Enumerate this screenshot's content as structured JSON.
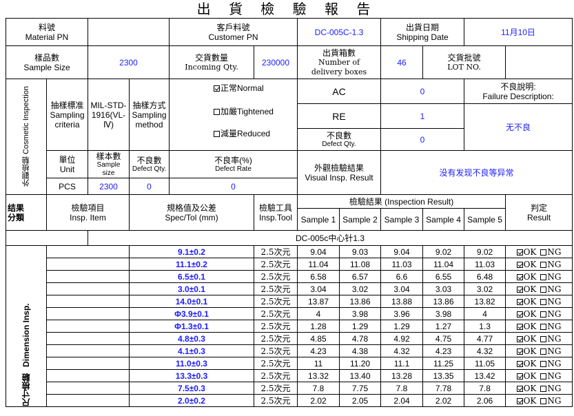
{
  "title": "出 貨 檢 驗 報 告",
  "header": {
    "material_pn_label_cn": "料號",
    "material_pn_label_en": "Material PN",
    "material_pn_value": "",
    "customer_pn_label_cn": "客戶料號",
    "customer_pn_label_en": "Customer PN",
    "customer_pn_value": "DC-005C-1.3",
    "shipping_date_label_cn": "出貨日期",
    "shipping_date_label_en": "Shipping Date",
    "shipping_date_value": "11月10日",
    "sample_size_label_cn": "樣品數",
    "sample_size_label_en": "Sample Size",
    "sample_size_value": "2300",
    "incoming_qty_label_cn": "交貨數量",
    "incoming_qty_label_en": "Incoming Qty.",
    "incoming_qty_value": "230000",
    "delivery_boxes_label_cn": "出貨箱數",
    "delivery_boxes_label_en1": "Number of",
    "delivery_boxes_label_en2": "delivery boxes",
    "delivery_boxes_value": "46",
    "lot_label_cn": "交貨批號",
    "lot_label_en": "LOT NO.",
    "lot_value": ""
  },
  "cosmetic": {
    "section_label": "外觀檢驗 Cosmetic Inspection",
    "sampling_criteria_cn": "抽樣標准",
    "sampling_criteria_en1": "Sampling",
    "sampling_criteria_en2": "criteria",
    "standard_1": "MIL-STD-",
    "standard_2": "1916(VL-",
    "standard_3": "Ⅳ)",
    "sampling_method_cn": "抽樣方式",
    "sampling_method_en1": "Sampling",
    "sampling_method_en2": "method",
    "options": [
      {
        "label": "正常Normal",
        "checked": true
      },
      {
        "label": "加嚴Tightened",
        "checked": false
      },
      {
        "label": "減量Reduced",
        "checked": false
      }
    ],
    "ac_label": "AC",
    "ac_value": "0",
    "re_label": "RE",
    "re_value": "1",
    "defect_qty_label_cn": "不良數",
    "defect_qty_label_en": "Defect Qty.",
    "defect_qty_value": "0",
    "failure_desc_label_cn": "不良說明:",
    "failure_desc_label_en": "Failure Description:",
    "failure_desc_value": "无不良",
    "unit_label_cn": "單位",
    "unit_label_en": "Unit",
    "sample_size_cn": "樣本數",
    "sample_size_en1": "Sample",
    "sample_size_en2": "size",
    "defect_qty2_cn": "不良數",
    "defect_qty2_en": "Defect Qty.",
    "defect_rate_cn": "不良率(%)",
    "defect_rate_en": "Defect Rate",
    "visual_result_cn": "外觀檢驗結果",
    "visual_result_en": "Visual Insp. Result",
    "visual_result_value": "没有发现不良等异常",
    "unit_value": "PCS",
    "sample_value": "2300",
    "defect_value": "0",
    "rate_value": "0"
  },
  "dimension": {
    "category_cn": "结果",
    "category_cn2": "分類",
    "insp_item_cn": "檢驗項目",
    "insp_item_en": "Insp. Item",
    "spec_cn": "規格值及公差",
    "spec_en": "Spec/Tol (mm)",
    "tool_cn": "檢驗工具",
    "tool_en": "Insp.Tool",
    "result_header": "檢驗結果 (Inspection Result)",
    "sample_headers": [
      "Sample 1",
      "Sample 2",
      "Sample 3",
      "Sample 4",
      "Sample 5"
    ],
    "judge_cn": "判定",
    "judge_en": "Result",
    "part_name": "DC-005c中心针1.3",
    "section_label_cn": "尺寸檢驗",
    "section_label_en": "Dimension Insp.",
    "ok_label": "OK",
    "ng_label": "NG",
    "rows": [
      {
        "spec": "9.1±0.2",
        "tool": "2.5次元",
        "s": [
          "9.04",
          "9.03",
          "9.04",
          "9.02",
          "9.02"
        ]
      },
      {
        "spec": "11.1±0.2",
        "tool": "2.5次元",
        "s": [
          "11.04",
          "11.08",
          "11.03",
          "11.04",
          "11.03"
        ]
      },
      {
        "spec": "6.5±0.1",
        "tool": "2.5次元",
        "s": [
          "6.58",
          "6.57",
          "6.6",
          "6.55",
          "6.48"
        ]
      },
      {
        "spec": "3.0±0.1",
        "tool": "2.5次元",
        "s": [
          "3.04",
          "3.02",
          "3.04",
          "3.03",
          "3.02"
        ]
      },
      {
        "spec": "14.0±0.1",
        "tool": "2.5次元",
        "s": [
          "13.87",
          "13.86",
          "13.88",
          "13.86",
          "13.82"
        ]
      },
      {
        "spec": "Φ3.9±0.1",
        "tool": "2.5次元",
        "s": [
          "4",
          "3.98",
          "3.96",
          "3.98",
          "4"
        ]
      },
      {
        "spec": "Φ1.3±0.1",
        "tool": "2.5次元",
        "s": [
          "1.28",
          "1.29",
          "1.29",
          "1.27",
          "1.3"
        ]
      },
      {
        "spec": "4.8±0.3",
        "tool": "2.5次元",
        "s": [
          "4.85",
          "4.78",
          "4.92",
          "4.75",
          "4.77"
        ]
      },
      {
        "spec": "4.1±0.3",
        "tool": "2.5次元",
        "s": [
          "4.23",
          "4.38",
          "4.32",
          "4.23",
          "4.32"
        ]
      },
      {
        "spec": "11.0±0.3",
        "tool": "2.5次元",
        "s": [
          "11",
          "11.20",
          "11.1",
          "11.25",
          "11.05"
        ]
      },
      {
        "spec": "13.3±0.3",
        "tool": "2.5次元",
        "s": [
          "13.32",
          "13.40",
          "13.28",
          "13.35",
          "13.42"
        ]
      },
      {
        "spec": "7.5±0.3",
        "tool": "2.5次元",
        "s": [
          "7.8",
          "7.75",
          "7.8",
          "7.78",
          "7.8"
        ]
      },
      {
        "spec": "2.0±0.2",
        "tool": "2.5次元",
        "s": [
          "2.02",
          "2.05",
          "2.04",
          "2.02",
          "2.06"
        ]
      }
    ]
  }
}
